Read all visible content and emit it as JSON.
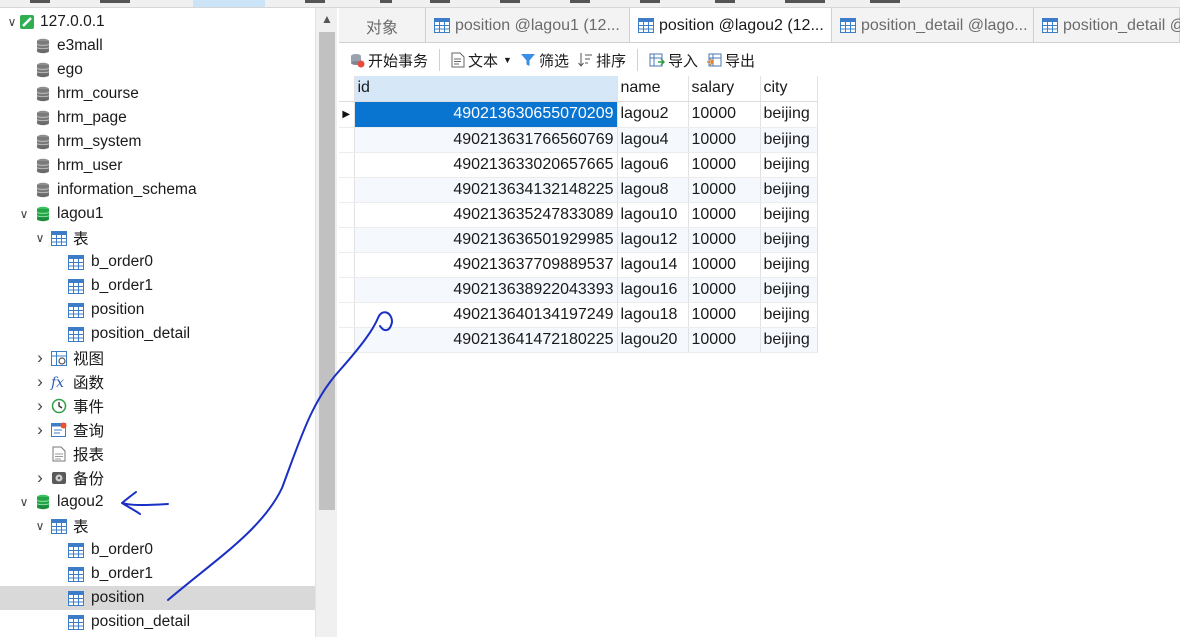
{
  "tree": [
    {
      "label": "127.0.0.1",
      "level": 0,
      "expanded": true,
      "icon": "connection-icon"
    },
    {
      "label": "e3mall",
      "level": 1,
      "icon": "database-icon"
    },
    {
      "label": "ego",
      "level": 1,
      "icon": "database-icon"
    },
    {
      "label": "hrm_course",
      "level": 1,
      "icon": "database-icon"
    },
    {
      "label": "hrm_page",
      "level": 1,
      "icon": "database-icon"
    },
    {
      "label": "hrm_system",
      "level": 1,
      "icon": "database-icon"
    },
    {
      "label": "hrm_user",
      "level": 1,
      "icon": "database-icon"
    },
    {
      "label": "information_schema",
      "level": 1,
      "icon": "database-icon"
    },
    {
      "label": "lagou1",
      "level": 1,
      "expanded": true,
      "icon": "database-open-icon"
    },
    {
      "label": "表",
      "level": 2,
      "expanded": true,
      "icon": "tables-icon"
    },
    {
      "label": "b_order0",
      "level": 3,
      "icon": "table-icon"
    },
    {
      "label": "b_order1",
      "level": 3,
      "icon": "table-icon"
    },
    {
      "label": "position",
      "level": 3,
      "icon": "table-icon"
    },
    {
      "label": "position_detail",
      "level": 3,
      "icon": "table-icon"
    },
    {
      "label": "视图",
      "level": 2,
      "expanded": false,
      "icon": "views-icon"
    },
    {
      "label": "函数",
      "level": 2,
      "expanded": false,
      "icon": "function-icon"
    },
    {
      "label": "事件",
      "level": 2,
      "expanded": false,
      "icon": "event-icon"
    },
    {
      "label": "查询",
      "level": 2,
      "expanded": false,
      "icon": "query-icon"
    },
    {
      "label": "报表",
      "level": 2,
      "icon": "report-icon"
    },
    {
      "label": "备份",
      "level": 2,
      "expanded": false,
      "icon": "backup-icon"
    },
    {
      "label": "lagou2",
      "level": 1,
      "expanded": true,
      "icon": "database-open-icon"
    },
    {
      "label": "表",
      "level": 2,
      "expanded": true,
      "icon": "tables-icon"
    },
    {
      "label": "b_order0",
      "level": 3,
      "icon": "table-icon"
    },
    {
      "label": "b_order1",
      "level": 3,
      "icon": "table-icon"
    },
    {
      "label": "position",
      "level": 3,
      "icon": "table-icon",
      "selected": true
    },
    {
      "label": "position_detail",
      "level": 3,
      "icon": "table-icon"
    }
  ],
  "tabs": [
    {
      "label": "对象",
      "active": false,
      "icon": ""
    },
    {
      "label": "position @lagou1 (12...",
      "active": false,
      "icon": "table-icon"
    },
    {
      "label": "position @lagou2 (12...",
      "active": true,
      "icon": "table-icon"
    },
    {
      "label": "position_detail @lago...",
      "active": false,
      "icon": "table-icon"
    },
    {
      "label": "position_detail @",
      "active": false,
      "icon": "table-icon"
    }
  ],
  "toolbar": {
    "begin_transaction": "开始事务",
    "text": "文本",
    "filter": "筛选",
    "sort": "排序",
    "import": "导入",
    "export": "导出"
  },
  "grid": {
    "columns": [
      "id",
      "name",
      "salary",
      "city"
    ],
    "rows": [
      [
        "490213630655070209",
        "lagou2",
        "10000",
        "beijing"
      ],
      [
        "490213631766560769",
        "lagou4",
        "10000",
        "beijing"
      ],
      [
        "490213633020657665",
        "lagou6",
        "10000",
        "beijing"
      ],
      [
        "490213634132148225",
        "lagou8",
        "10000",
        "beijing"
      ],
      [
        "490213635247833089",
        "lagou10",
        "10000",
        "beijing"
      ],
      [
        "490213636501929985",
        "lagou12",
        "10000",
        "beijing"
      ],
      [
        "490213637709889537",
        "lagou14",
        "10000",
        "beijing"
      ],
      [
        "490213638922043393",
        "lagou16",
        "10000",
        "beijing"
      ],
      [
        "490213640134197249",
        "lagou18",
        "10000",
        "beijing"
      ],
      [
        "490213641472180225",
        "lagou20",
        "10000",
        "beijing"
      ]
    ]
  },
  "colors": {
    "selection": "#0a74d1",
    "annotation_ink": "#1a2fc4",
    "db_green": "#1aa34a"
  }
}
